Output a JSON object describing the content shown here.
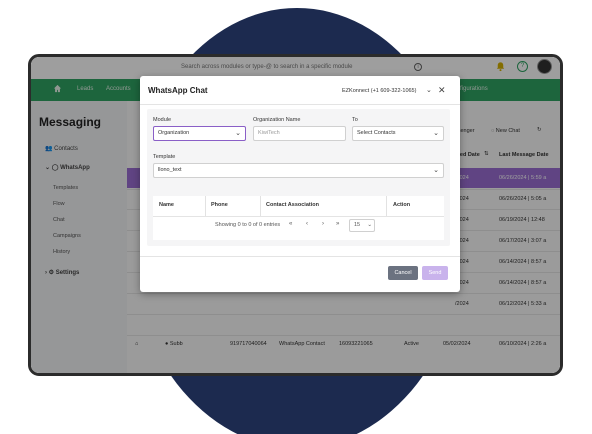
{
  "topbar": {
    "search_placeholder": "Search across modules or type-@ to search in a specific module",
    "info_icon": "i",
    "bell_icon": "bell-icon",
    "help_icon": "?"
  },
  "nav": {
    "items": [
      "Leads",
      "Accounts"
    ],
    "right_item": "Configurations"
  },
  "sidebar": {
    "title": "Messaging",
    "contacts": "Contacts",
    "whatsapp": "WhatsApp",
    "sub_items": [
      "Templates",
      "Flow",
      "Chat",
      "Campaigns",
      "History"
    ],
    "settings": "Settings"
  },
  "main": {
    "messenger": "ssenger",
    "new_chat": "New Chat",
    "col_created": "ated Date",
    "col_last": "Last Message Date",
    "created_dates": [
      "/2024",
      "/2024",
      "/2024",
      "/2024",
      "/2024",
      "/2024",
      "/2024",
      "05/02/2024"
    ],
    "last_dates": [
      "06/26/2024 | 5:59 a",
      "06/26/2024 | 5:05 a",
      "06/19/2024 | 12:48",
      "06/17/2024 | 3:07 a",
      "06/14/2024 | 8:57 a",
      "06/14/2024 | 8:57 a",
      "06/12/2024 | 5:33 a",
      "06/10/2024 | 2:26 a"
    ],
    "bottom_row": {
      "name": "Subb",
      "phone": "919717040064",
      "type": "WhatsApp Contact",
      "assoc": "16093221065",
      "status": "Active"
    }
  },
  "modal": {
    "title": "WhatsApp Chat",
    "phone": "EZKonnect (+1 609-322-1065)",
    "close": "✕",
    "module_label": "Module",
    "module_value": "Organization",
    "org_label": "Organization Name",
    "org_value": "KiwiTech",
    "to_label": "To",
    "to_value": "Select Contacts",
    "template_label": "Template",
    "template_value": "llono_text",
    "table_headers": [
      "Name",
      "Phone",
      "Contact Association",
      "Action"
    ],
    "table_footer": "Showing 0 to 0 of 0 entries",
    "pager": [
      "«",
      "‹",
      "›",
      "»"
    ],
    "page_size": "15",
    "cancel": "Cancel",
    "send": "Send"
  },
  "colors": {
    "nav_green": "#2fa363",
    "accent_purple": "#9b6fd4",
    "circle_navy": "#1c2a4f",
    "cancel_gray": "#6b7280",
    "send_disabled": "#c9b3ec"
  }
}
